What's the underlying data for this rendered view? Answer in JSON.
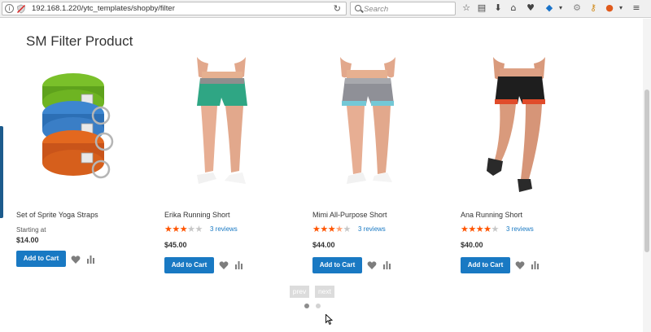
{
  "browser": {
    "url": "192.168.1.220/ytc_templates/shopby/filter",
    "search_placeholder": "Search",
    "reload_icon": "reload-icon"
  },
  "page": {
    "title": "SM Filter Product"
  },
  "products": [
    {
      "name": "Set of Sprite Yoga Straps",
      "price_prefix": "Starting at",
      "price": "$14.00",
      "add_to_cart": "Add to Cart",
      "rating": null,
      "reviews": ""
    },
    {
      "name": "Erika Running Short",
      "price": "$45.00",
      "add_to_cart": "Add to Cart",
      "rating": 3,
      "reviews": "3 reviews"
    },
    {
      "name": "Mimi All-Purpose Short",
      "price": "$44.00",
      "add_to_cart": "Add to Cart",
      "rating": 3.5,
      "reviews": "3 reviews"
    },
    {
      "name": "Ana Running Short",
      "price": "$40.00",
      "add_to_cart": "Add to Cart",
      "rating": 4,
      "reviews": "3 reviews"
    }
  ],
  "pager": {
    "prev": "prev",
    "next": "next",
    "current_page": 1,
    "total_pages": 2
  },
  "colors": {
    "accent": "#1979c3",
    "star": "#ff5501",
    "star_empty": "#c7c7c7"
  }
}
